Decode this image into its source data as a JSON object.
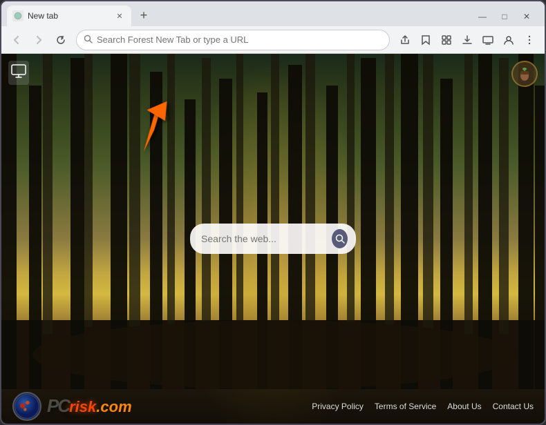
{
  "browser": {
    "tab_title": "New tab",
    "new_tab_label": "+",
    "window_minimize": "—",
    "window_maximize": "□",
    "window_close": "✕",
    "window_controls_collapse": "⌄",
    "omnibox_placeholder": "Search Forest New Tab or type a URL",
    "nav_back": "‹",
    "nav_forward": "›",
    "nav_refresh": "↻"
  },
  "toolbar_icons": {
    "share": "⇧",
    "bookmark": "☆",
    "extensions": "🧩",
    "download": "⬇",
    "cast": "▭",
    "profile": "👤",
    "menu": "⋮"
  },
  "page": {
    "search_placeholder": "Search the web...",
    "search_btn_icon": "🔍",
    "arrow_icon": "➜"
  },
  "bottom_bar": {
    "logo_pc": "PC",
    "logo_risk": "risk",
    "logo_com": ".com",
    "links": [
      {
        "label": "Privacy Policy",
        "url": "#"
      },
      {
        "label": "Terms of Service",
        "url": "#"
      },
      {
        "label": "About Us",
        "url": "#"
      },
      {
        "label": "Contact Us",
        "url": "#"
      }
    ]
  },
  "icons": {
    "display_icon": "🖥",
    "acorn_icon": "🌰",
    "search_icon": "🔍"
  }
}
